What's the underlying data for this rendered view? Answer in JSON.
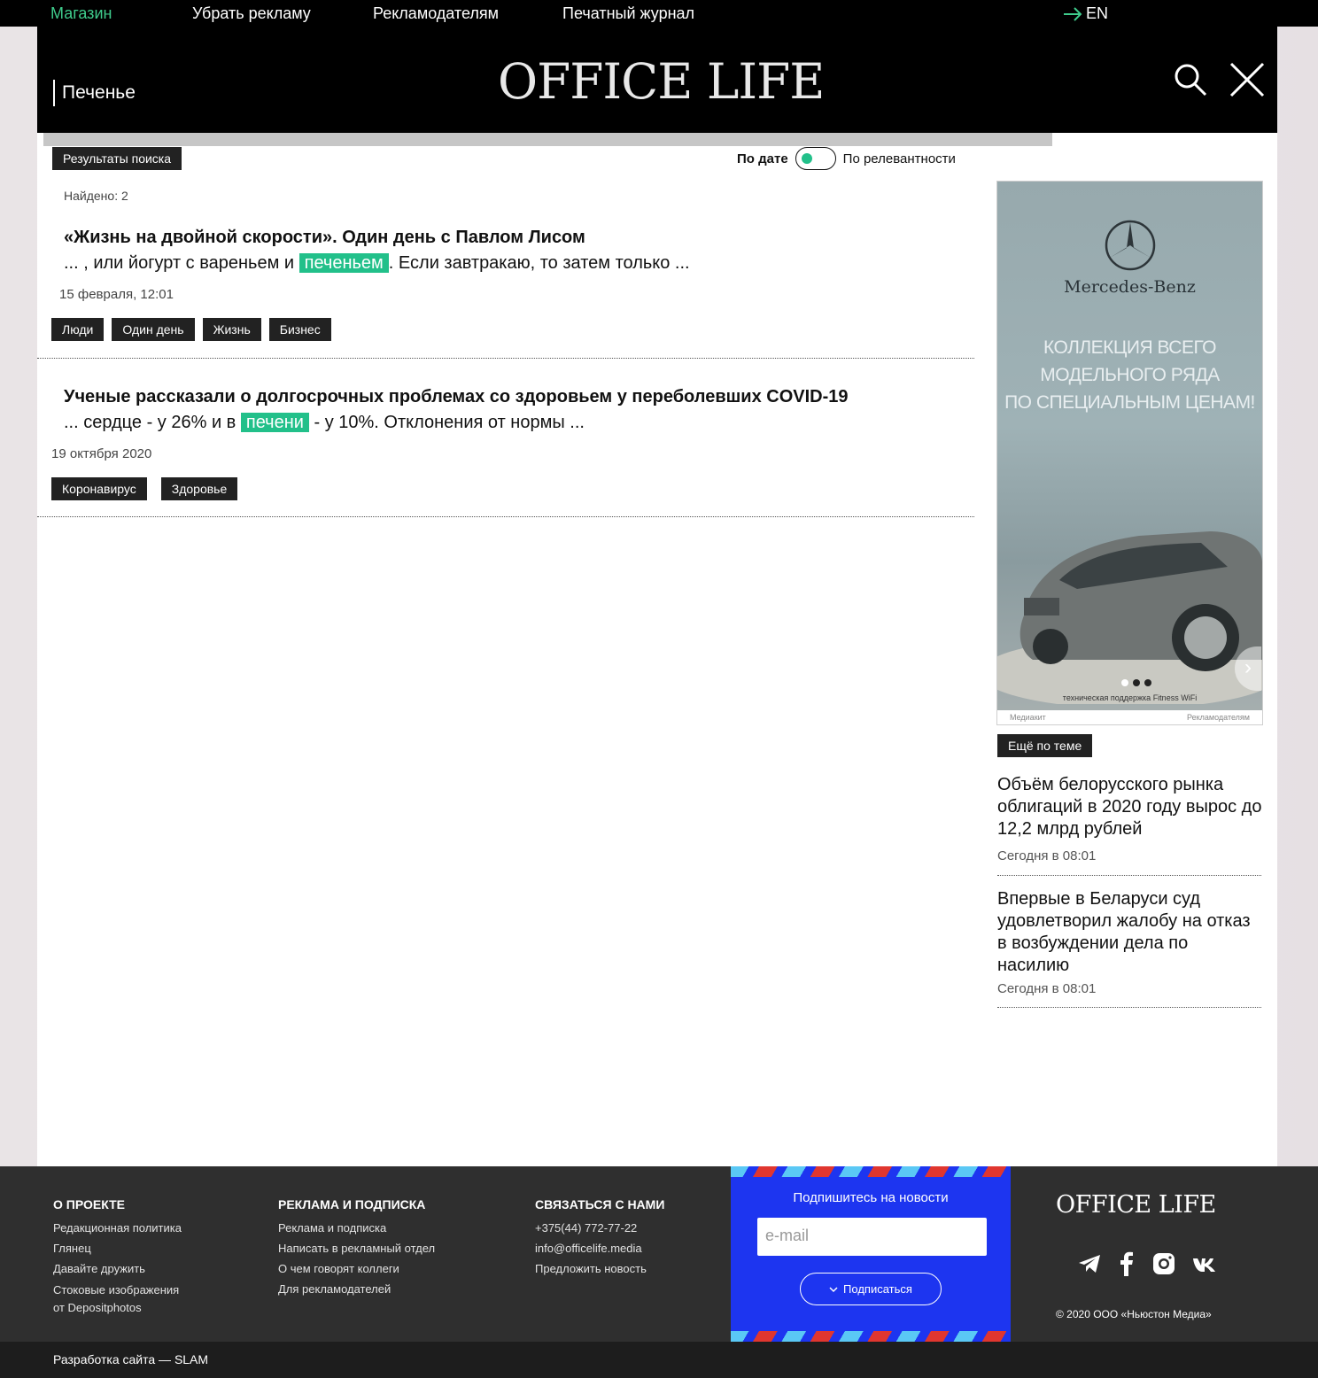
{
  "topbar": {
    "shop": "Магазин",
    "remove_ads": "Убрать рекламу",
    "advertisers": "Рекламодателям",
    "print_magazine": "Печатный журнал",
    "lang": "EN",
    "lang_icon": "arrow-right-icon",
    "accent": "#3fcc8c"
  },
  "header": {
    "logo": "OFFICE LIFE",
    "search_query": "Печенье",
    "search_icon": "search-icon",
    "close_icon": "close-icon"
  },
  "search": {
    "results_label": "Результаты поиска",
    "sort_by_date": "По дате",
    "sort_by_relevance": "По релевантности",
    "found": "Найдено: 2",
    "highlight_color": "#22c08a"
  },
  "results": [
    {
      "title": "«Жизнь на двойной скорости». Один день с Павлом Лисом",
      "snippet_before": "... , или йогурт с вареньем и ",
      "snippet_highlight": "печеньем",
      "snippet_after": ". Если завтракаю, то затем только ...",
      "date": "15 февраля, 12:01",
      "tags": [
        "Люди",
        "Один день",
        "Жизнь",
        "Бизнес"
      ]
    },
    {
      "title": "Ученые рассказали о долгосрочных проблемах со здоровьем у переболевших COVID-19",
      "snippet_before": "... сердце - у 26% и в ",
      "snippet_highlight": "печени",
      "snippet_after": " - у 10%. Отклонения от нормы ...",
      "date": "19 октября 2020",
      "tags": [
        "Коронавирус",
        "Здоровье"
      ]
    }
  ],
  "ad": {
    "brand": "Mercedes-Benz",
    "text_line1": "КОЛЛЕКЦИЯ ВСЕГО",
    "text_line2": "МОДЕЛЬНОГО РЯДА",
    "text_line3": "ПО СПЕЦИАЛЬНЫМ ЦЕНАМ!",
    "support": "техническая поддержка Fitness WiFi",
    "mediakit": "Медиакит",
    "advertisers": "Рекламодателям"
  },
  "sidebar": {
    "more_label": "Ещё по теме",
    "items": [
      {
        "title": "Объём белорусского рынка облигаций в 2020 году вырос до 12,2 млрд рублей",
        "date": "Сегодня в 08:01"
      },
      {
        "title": "Впервые в Беларуси суд удовлетворил жалобу на отказ в возбуждении дела по насилию",
        "date": "Сегодня в 08:01"
      }
    ]
  },
  "footer": {
    "about": {
      "heading": "О ПРОЕКТЕ",
      "links": [
        "Редакционная политика",
        "Глянец",
        "Давайте дружить",
        "Стоковые изображения",
        "от Depositphotos"
      ]
    },
    "ads": {
      "heading": "РЕКЛАМА И ПОДПИСКА",
      "links": [
        "Реклама и подписка",
        "Написать в рекламный отдел",
        "О чем говорят коллеги",
        "Для рекламодателей"
      ]
    },
    "contact": {
      "heading": "СВЯЗАТЬСЯ С НАМИ",
      "links": [
        "+375(44) 772-77-22",
        "info@officelife.media",
        "Предложить новость"
      ]
    },
    "subscribe": {
      "title": "Подпишитесь на новости",
      "placeholder": "e-mail",
      "button": "Подписаться",
      "bg": "#1d35f0"
    },
    "logo": "OFFICE LIFE",
    "social": [
      "telegram-icon",
      "facebook-icon",
      "instagram-icon",
      "vk-icon"
    ],
    "copyright": "© 2020 ООО «Ньюстон Медиа»",
    "dev": "Разработка сайта — SLAM"
  }
}
